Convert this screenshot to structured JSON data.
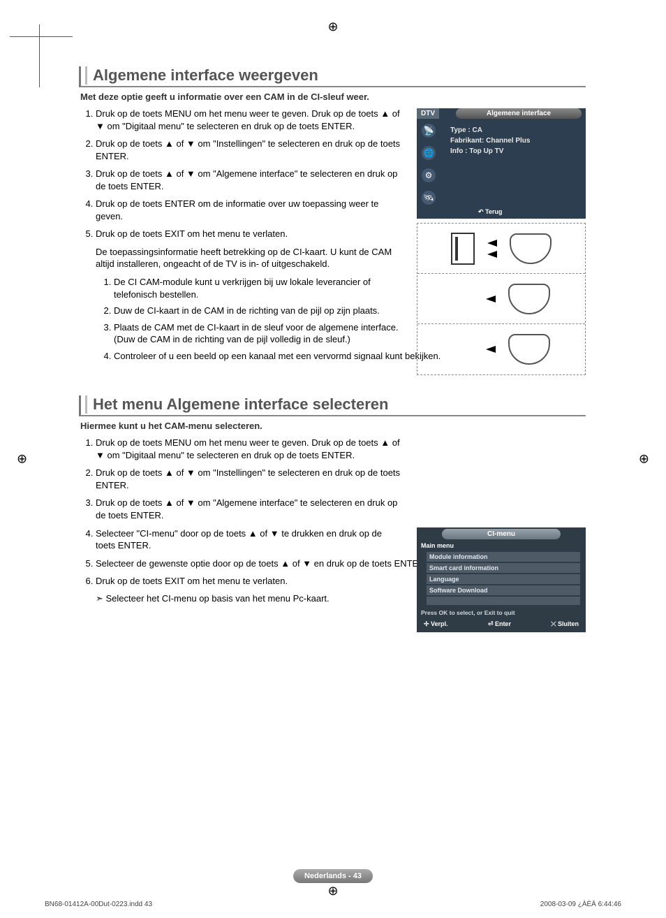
{
  "page": {
    "footer_label": "Nederlands - 43",
    "imprint_left": "BN68-01412A-00Dut-0223.indd   43",
    "imprint_right": "2008-03-09   ¿ÀÈÄ 6:44:46"
  },
  "section1": {
    "heading": "Algemene interface weergeven",
    "lead": "Met deze optie geeft u informatie over een CAM in de CI-sleuf weer.",
    "steps": [
      "Druk op de toets MENU om het menu weer te geven. Druk op de toets ▲ of ▼ om \"Digitaal menu\" te selecteren en druk op de toets ENTER.",
      "Druk op de toets ▲ of ▼ om \"Instellingen\" te selecteren en druk op de toets ENTER.",
      "Druk op de toets ▲ of ▼ om \"Algemene interface\" te selecteren en druk op de toets ENTER.",
      "Druk op de toets ENTER om de informatie over uw toepassing weer te geven.",
      "Druk op de toets EXIT om het menu te verlaten."
    ],
    "tail_para": "De toepassingsinformatie heeft betrekking op de CI-kaart. U kunt de CAM altijd installeren, ongeacht of de TV is in- of uitgeschakeld.",
    "substeps": [
      "De CI CAM-module kunt u verkrijgen bij uw lokale leverancier of telefonisch bestellen.",
      "Duw de CI-kaart in de CAM in de richting van de pijl op zijn plaats.",
      "Plaats de CAM met de CI-kaart in de sleuf voor de algemene interface. (Duw de CAM in de richting van de pijl volledig in de sleuf.)",
      "Controleer of u een beeld op een kanaal met een vervormd signaal kunt bekijken."
    ]
  },
  "tvmenu1": {
    "tab": "DTV",
    "title": "Algemene interface",
    "line1": "Type : CA",
    "line2": "Fabrikant: Channel Plus",
    "line3": "Info : Top Up TV",
    "back": "Terug"
  },
  "section2": {
    "heading": "Het menu Algemene interface selecteren",
    "lead": "Hiermee kunt u het CAM-menu selecteren.",
    "steps": [
      "Druk op de toets MENU om het menu weer te geven. Druk op de toets ▲ of ▼ om \"Digitaal menu\" te selecteren en druk op de toets ENTER.",
      "Druk op de toets ▲ of ▼ om \"Instellingen\" te selecteren en druk op de toets ENTER.",
      "Druk op de toets ▲ of ▼ om \"Algemene interface\" te selecteren en druk op de toets ENTER.",
      "Selecteer \"CI-menu\" door op de toets ▲ of ▼ te drukken en druk op de toets ENTER.",
      "Selecteer de gewenste optie door op de toets ▲ of ▼ en druk op de toets ENTER.",
      "Druk op de toets EXIT om het menu te verlaten."
    ],
    "note": "Selecteer het CI-menu op basis van het menu Pc-kaart."
  },
  "tvmenu2": {
    "title": "CI-menu",
    "main": "Main menu",
    "items": [
      "Module information",
      "Smart card information",
      "Language",
      "Software Download"
    ],
    "hint": "Press OK to select, or Exit to quit",
    "nav_move": "Verpl.",
    "nav_enter": "Enter",
    "nav_exit": "Sluiten"
  }
}
